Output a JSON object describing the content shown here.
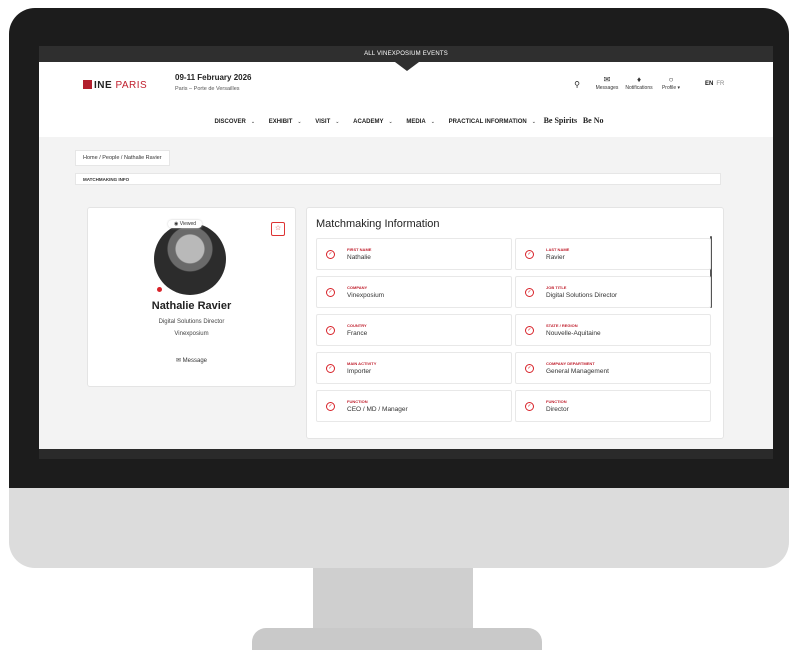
{
  "topbar": {
    "label": "ALL VINEXPOSIUM EVENTS"
  },
  "header": {
    "logo": {
      "mark": "INE",
      "rest": "PARIS"
    },
    "dates": "09-11 February 2026",
    "venue": "Paris – Porte de Versailles",
    "icons": {
      "search": "search-icon",
      "messages_label": "Messages",
      "notifications_label": "Notifications",
      "profile_label": "Profile ▾"
    },
    "lang": {
      "en": "EN",
      "fr": "FR"
    }
  },
  "nav": {
    "items": [
      "DISCOVER",
      "EXHIBIT",
      "VISIT",
      "ACADEMY",
      "MEDIA",
      "PRACTICAL INFORMATION"
    ],
    "brand1": "Be Spirits",
    "brand2": "Be No"
  },
  "breadcrumb": "Home / People / Nathalie Ravier",
  "tab": "MATCHMAKING INFO",
  "profile": {
    "viewed": "Viewed",
    "name": "Nathalie Ravier",
    "title": "Digital Solutions Director",
    "company": "Vinexposium",
    "message": "Message"
  },
  "matchmaking": {
    "title": "Matchmaking Information",
    "fields": [
      {
        "label": "FIRST NAME",
        "value": "Nathalie"
      },
      {
        "label": "LAST NAME",
        "value": "Ravier"
      },
      {
        "label": "COMPANY",
        "value": "Vinexposium"
      },
      {
        "label": "JOB TITLE",
        "value": "Digital Solutions Director"
      },
      {
        "label": "COUNTRY",
        "value": "France"
      },
      {
        "label": "STATE / REGION",
        "value": "Nouvelle-Aquitaine"
      },
      {
        "label": "MAIN ACTIVITY",
        "value": "Importer"
      },
      {
        "label": "COMPANY DEPARTMENT",
        "value": "General Management"
      },
      {
        "label": "FUNCTION",
        "value": "CEO / MD / Manager"
      },
      {
        "label": "FUNCTION",
        "value": "Director"
      }
    ]
  },
  "colors": {
    "accent": "#c0202e",
    "dark": "#2f2f2f"
  }
}
